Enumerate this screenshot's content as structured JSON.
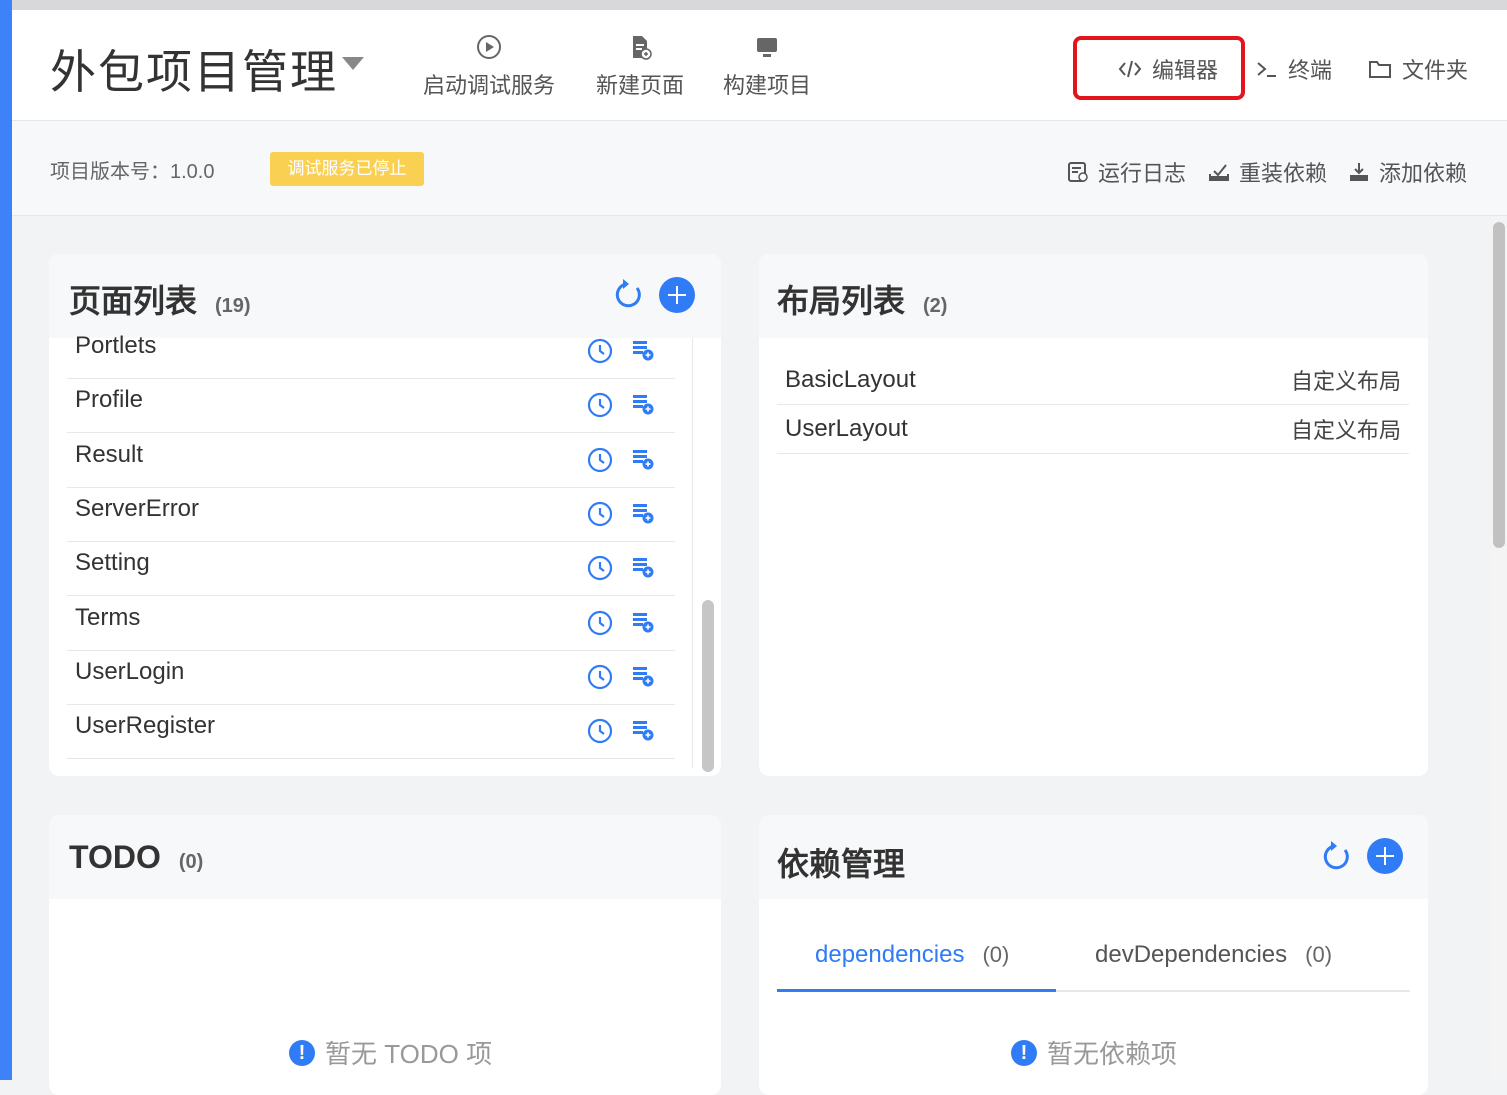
{
  "project": {
    "title": "外包项目管理"
  },
  "header": {
    "actions": [
      {
        "label": "启动调试服务",
        "icon": "play-circle-icon"
      },
      {
        "label": "新建页面",
        "icon": "new-page-icon"
      },
      {
        "label": "构建项目",
        "icon": "monitor-icon"
      }
    ],
    "right": {
      "editor": "编辑器",
      "terminal": "终端",
      "folder": "文件夹"
    }
  },
  "subbar": {
    "version_label": "项目版本号：",
    "version": "1.0.0",
    "status_badge": "调试服务已停止",
    "run_log": "运行日志",
    "reinstall": "重装依赖",
    "add_dep": "添加依赖"
  },
  "pages": {
    "title": "页面列表",
    "count": "(19)",
    "items": [
      "Portlets",
      "Profile",
      "Result",
      "ServerError",
      "Setting",
      "Terms",
      "UserLogin",
      "UserRegister"
    ]
  },
  "layouts": {
    "title": "布局列表",
    "count": "(2)",
    "items": [
      {
        "name": "BasicLayout",
        "type": "自定义布局"
      },
      {
        "name": "UserLayout",
        "type": "自定义布局"
      }
    ]
  },
  "todo": {
    "title": "TODO",
    "count": "(0)",
    "empty": "暂无 TODO 项"
  },
  "deps": {
    "title": "依赖管理",
    "tabs": [
      {
        "label": "dependencies",
        "count": "(0)"
      },
      {
        "label": "devDependencies",
        "count": "(0)"
      }
    ],
    "empty": "暂无依赖项"
  },
  "colors": {
    "accent": "#2f7cf6",
    "badge": "#fad052",
    "highlight": "#e3141d",
    "sidebar": "#3d82f7"
  }
}
